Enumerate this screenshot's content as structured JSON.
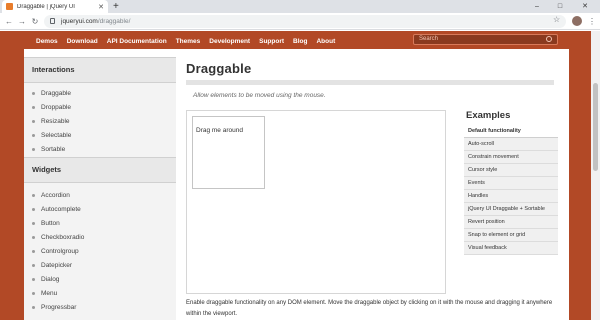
{
  "browser": {
    "tab_title": "Draggable | jQuery UI",
    "url_host": "jqueryui.com",
    "url_path": "/draggable/"
  },
  "topnav": {
    "items": [
      "Demos",
      "Download",
      "API Documentation",
      "Themes",
      "Development",
      "Support",
      "Blog",
      "About"
    ],
    "search_placeholder": "Search"
  },
  "sidebar": {
    "interactions_heading": "Interactions",
    "interactions": [
      "Draggable",
      "Droppable",
      "Resizable",
      "Selectable",
      "Sortable"
    ],
    "widgets_heading": "Widgets",
    "widgets": [
      "Accordion",
      "Autocomplete",
      "Button",
      "Checkboxradio",
      "Controlgroup",
      "Datepicker",
      "Dialog",
      "Menu",
      "Progressbar"
    ]
  },
  "main": {
    "title": "Draggable",
    "subtitle": "Allow elements to be moved using the mouse.",
    "draggable_label": "Drag me around",
    "description": "Enable draggable functionality on any DOM element. Move the draggable object by clicking on it with the mouse and dragging it anywhere within the viewport."
  },
  "examples": {
    "heading": "Examples",
    "items": [
      "Default functionality",
      "Auto-scroll",
      "Constrain movement",
      "Cursor style",
      "Events",
      "Handles",
      "jQuery UI Draggable + Sortable",
      "Revert position",
      "Snap to element or grid",
      "Visual feedback"
    ]
  },
  "colors": {
    "brand": "#b24926",
    "sidebar_bg": "#f3f3f3"
  }
}
